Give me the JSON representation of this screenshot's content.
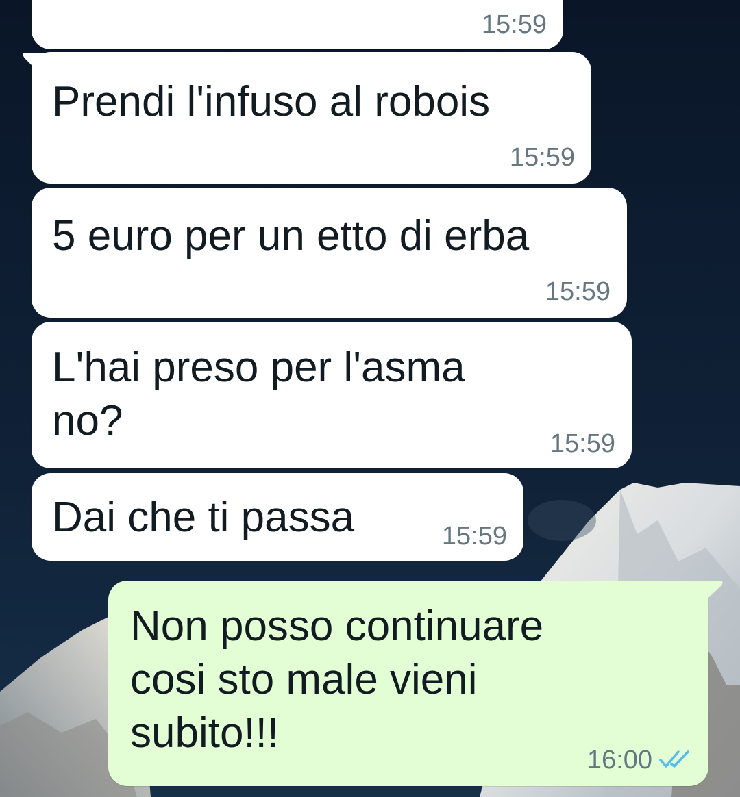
{
  "messages": [
    {
      "direction": "in",
      "text": "",
      "time": "15:59"
    },
    {
      "direction": "in",
      "text": "Prendi l'infuso al robois",
      "time": "15:59"
    },
    {
      "direction": "in",
      "text": "5 euro per un etto di erba",
      "time": "15:59"
    },
    {
      "direction": "in",
      "text": "L'hai preso per l'asma\nno?",
      "time": "15:59"
    },
    {
      "direction": "in",
      "text": "Dai che ti passa",
      "time": "15:59"
    },
    {
      "direction": "out",
      "text": "Non posso continuare\ncosi sto male vieni\nsubito!!!",
      "time": "16:00",
      "status": "read",
      "status_icon": "double-check-icon"
    }
  ],
  "colors": {
    "incoming_bubble": "#ffffff",
    "outgoing_bubble": "#e3fed4",
    "read_ticks": "#53bdeb",
    "time_text": "#667781",
    "wallpaper_sky": "#0d1b2f"
  }
}
